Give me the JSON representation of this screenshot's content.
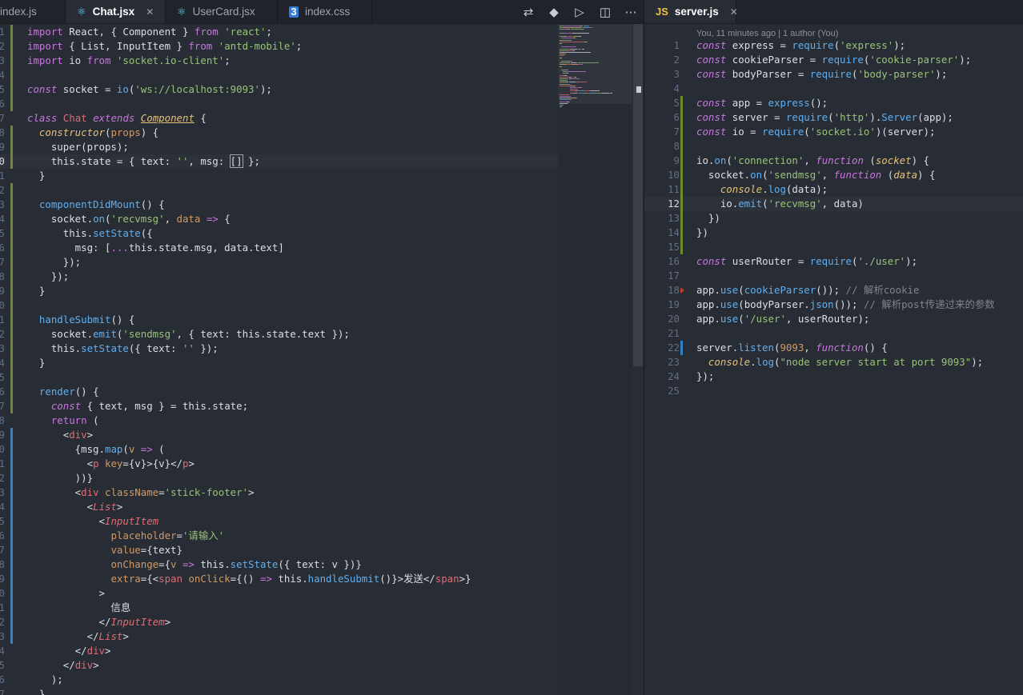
{
  "left_tabs": [
    {
      "label": "index.js",
      "icon": "none",
      "active": false
    },
    {
      "label": "Chat.jsx",
      "icon": "react-icon",
      "active": true
    },
    {
      "label": "UserCard.jsx",
      "icon": "react-icon",
      "active": false
    },
    {
      "label": "index.css",
      "icon": "css3-icon",
      "active": false
    }
  ],
  "right_tabs": [
    {
      "label": "server.js",
      "icon": "js-icon",
      "active": true
    }
  ],
  "toolbar_icons": [
    "compare-icon",
    "git-icon",
    "run-icon",
    "split-editor-icon",
    "more-icon"
  ],
  "server_codelens": "You, 11 minutes ago | 1 author (You)",
  "colors": {
    "keyword": "#c678dd",
    "string": "#98c379",
    "function": "#61afef",
    "tag": "#e06c75",
    "number": "#d19a66",
    "comment": "#7f848e"
  },
  "left_numbers": [
    "1",
    "2",
    "3",
    "4",
    "5",
    "6",
    "7",
    "8",
    "9",
    "0",
    "1",
    "2",
    "3",
    "4",
    "5",
    "6",
    "7",
    "8",
    "9",
    "0",
    "1",
    "2",
    "3",
    "4",
    "5",
    "6",
    "7",
    "8",
    "9",
    "0",
    "1",
    "2",
    "3",
    "4",
    "5",
    "6",
    "7",
    "8",
    "9",
    "0",
    "1",
    "2",
    "3",
    "4",
    "5",
    "6",
    "7"
  ],
  "left_current_line_index": 9,
  "left_code": [
    [
      [
        "k",
        "import"
      ],
      [
        "pl",
        " React, { Component } "
      ],
      [
        "k",
        "from"
      ],
      [
        "pl",
        " "
      ],
      [
        "s",
        "'react'"
      ],
      [
        "pl",
        ";"
      ]
    ],
    [
      [
        "k",
        "import"
      ],
      [
        "pl",
        " { List, InputItem } "
      ],
      [
        "k",
        "from"
      ],
      [
        "pl",
        " "
      ],
      [
        "s",
        "'antd-mobile'"
      ],
      [
        "pl",
        ";"
      ]
    ],
    [
      [
        "k",
        "import"
      ],
      [
        "pl",
        " io "
      ],
      [
        "k",
        "from"
      ],
      [
        "pl",
        " "
      ],
      [
        "s",
        "'socket.io-client'"
      ],
      [
        "pl",
        ";"
      ]
    ],
    [],
    [
      [
        "ki",
        "const"
      ],
      [
        "pl",
        " socket = "
      ],
      [
        "f",
        "io"
      ],
      [
        "pl",
        "("
      ],
      [
        "s",
        "'ws://localhost:9093'"
      ],
      [
        "pl",
        ");"
      ]
    ],
    [],
    [
      [
        "ki",
        "class"
      ],
      [
        "pl",
        " "
      ],
      [
        "t",
        "Chat"
      ],
      [
        "pl",
        " "
      ],
      [
        "ki",
        "extends"
      ],
      [
        "pl",
        " "
      ],
      [
        "pu",
        "Component"
      ],
      [
        "pl",
        " {"
      ]
    ],
    [
      [
        "pl",
        "  "
      ],
      [
        "p",
        "constructor"
      ],
      [
        "pl",
        "("
      ],
      [
        "a",
        "props"
      ],
      [
        "pl",
        ") {"
      ]
    ],
    [
      [
        "pl",
        "    super(props);"
      ]
    ],
    [
      [
        "pl",
        "    this.state = { text: "
      ],
      [
        "s",
        "''"
      ],
      [
        "pl",
        ", msg: "
      ],
      [
        "box",
        "[]"
      ],
      [
        "pl",
        " };"
      ]
    ],
    [
      [
        "pl",
        "  }"
      ]
    ],
    [],
    [
      [
        "pl",
        "  "
      ],
      [
        "f",
        "componentDidMount"
      ],
      [
        "pl",
        "() {"
      ]
    ],
    [
      [
        "pl",
        "    socket."
      ],
      [
        "f",
        "on"
      ],
      [
        "pl",
        "("
      ],
      [
        "s",
        "'recvmsg'"
      ],
      [
        "pl",
        ", "
      ],
      [
        "a",
        "data"
      ],
      [
        "pl",
        " "
      ],
      [
        "k",
        "=>"
      ],
      [
        "pl",
        " {"
      ]
    ],
    [
      [
        "pl",
        "      this."
      ],
      [
        "f",
        "setState"
      ],
      [
        "pl",
        "({"
      ]
    ],
    [
      [
        "pl",
        "        msg: ["
      ],
      [
        "k",
        "..."
      ],
      [
        "pl",
        "this.state.msg, data.text]"
      ]
    ],
    [
      [
        "pl",
        "      });"
      ]
    ],
    [
      [
        "pl",
        "    });"
      ]
    ],
    [
      [
        "pl",
        "  }"
      ]
    ],
    [],
    [
      [
        "pl",
        "  "
      ],
      [
        "f",
        "handleSubmit"
      ],
      [
        "pl",
        "() {"
      ]
    ],
    [
      [
        "pl",
        "    socket."
      ],
      [
        "f",
        "emit"
      ],
      [
        "pl",
        "("
      ],
      [
        "s",
        "'sendmsg'"
      ],
      [
        "pl",
        ", { text: this.state.text });"
      ]
    ],
    [
      [
        "pl",
        "    this."
      ],
      [
        "f",
        "setState"
      ],
      [
        "pl",
        "({ text: "
      ],
      [
        "s",
        "''"
      ],
      [
        "pl",
        " });"
      ]
    ],
    [
      [
        "pl",
        "  }"
      ]
    ],
    [],
    [
      [
        "pl",
        "  "
      ],
      [
        "f",
        "render"
      ],
      [
        "pl",
        "() {"
      ]
    ],
    [
      [
        "pl",
        "    "
      ],
      [
        "ki",
        "const"
      ],
      [
        "pl",
        " { text, msg } = this.state;"
      ]
    ],
    [
      [
        "pl",
        "    "
      ],
      [
        "k",
        "return"
      ],
      [
        "pl",
        " ("
      ]
    ],
    [
      [
        "pl",
        "      <"
      ],
      [
        "t",
        "div"
      ],
      [
        "pl",
        ">"
      ]
    ],
    [
      [
        "pl",
        "        {msg."
      ],
      [
        "f",
        "map"
      ],
      [
        "pl",
        "("
      ],
      [
        "a",
        "v"
      ],
      [
        "pl",
        " "
      ],
      [
        "k",
        "=>"
      ],
      [
        "pl",
        " ("
      ]
    ],
    [
      [
        "pl",
        "          <"
      ],
      [
        "t",
        "p"
      ],
      [
        "pl",
        " "
      ],
      [
        "a",
        "key"
      ],
      [
        "pl",
        "={v}>{v}</"
      ],
      [
        "t",
        "p"
      ],
      [
        "pl",
        ">"
      ]
    ],
    [
      [
        "pl",
        "        ))}"
      ]
    ],
    [
      [
        "pl",
        "        <"
      ],
      [
        "t",
        "div"
      ],
      [
        "pl",
        " "
      ],
      [
        "a",
        "className"
      ],
      [
        "pl",
        "="
      ],
      [
        "s",
        "'stick-footer'"
      ],
      [
        "pl",
        ">"
      ]
    ],
    [
      [
        "pl",
        "          <"
      ],
      [
        "ti",
        "List"
      ],
      [
        "pl",
        ">"
      ]
    ],
    [
      [
        "pl",
        "            <"
      ],
      [
        "ti",
        "InputItem"
      ]
    ],
    [
      [
        "pl",
        "              "
      ],
      [
        "a",
        "placeholder"
      ],
      [
        "pl",
        "="
      ],
      [
        "s",
        "'请输入'"
      ]
    ],
    [
      [
        "pl",
        "              "
      ],
      [
        "a",
        "value"
      ],
      [
        "pl",
        "={text}"
      ]
    ],
    [
      [
        "pl",
        "              "
      ],
      [
        "a",
        "onChange"
      ],
      [
        "pl",
        "={"
      ],
      [
        "a",
        "v"
      ],
      [
        "pl",
        " "
      ],
      [
        "k",
        "=>"
      ],
      [
        "pl",
        " this."
      ],
      [
        "f",
        "setState"
      ],
      [
        "pl",
        "({ text: v })}"
      ]
    ],
    [
      [
        "pl",
        "              "
      ],
      [
        "a",
        "extra"
      ],
      [
        "pl",
        "={<"
      ],
      [
        "t",
        "span"
      ],
      [
        "pl",
        " "
      ],
      [
        "a",
        "onClick"
      ],
      [
        "pl",
        "={() "
      ],
      [
        "k",
        "=>"
      ],
      [
        "pl",
        " this."
      ],
      [
        "f",
        "handleSubmit"
      ],
      [
        "pl",
        "()}>发送</"
      ],
      [
        "t",
        "span"
      ],
      [
        "pl",
        ">}"
      ]
    ],
    [
      [
        "pl",
        "            >"
      ]
    ],
    [
      [
        "pl",
        "              信息"
      ]
    ],
    [
      [
        "pl",
        "            </"
      ],
      [
        "ti",
        "InputItem"
      ],
      [
        "pl",
        ">"
      ]
    ],
    [
      [
        "pl",
        "          </"
      ],
      [
        "ti",
        "List"
      ],
      [
        "pl",
        ">"
      ]
    ],
    [
      [
        "pl",
        "        </"
      ],
      [
        "t",
        "div"
      ],
      [
        "pl",
        ">"
      ]
    ],
    [
      [
        "pl",
        "      </"
      ],
      [
        "t",
        "div"
      ],
      [
        "pl",
        ">"
      ]
    ],
    [
      [
        "pl",
        "    );"
      ]
    ],
    [
      [
        "pl",
        "  }"
      ]
    ]
  ],
  "right_numbers": [
    "1",
    "2",
    "3",
    "4",
    "5",
    "6",
    "7",
    "8",
    "9",
    "10",
    "11",
    "12",
    "13",
    "14",
    "15",
    "16",
    "17",
    "18",
    "19",
    "20",
    "21",
    "22",
    "23",
    "24",
    "25"
  ],
  "right_current_line_index": 11,
  "right_code": [
    [
      [
        "ki",
        "const"
      ],
      [
        "pl",
        " express = "
      ],
      [
        "f",
        "require"
      ],
      [
        "pl",
        "("
      ],
      [
        "s",
        "'express'"
      ],
      [
        "pl",
        ");"
      ]
    ],
    [
      [
        "ki",
        "const"
      ],
      [
        "pl",
        " cookieParser = "
      ],
      [
        "f",
        "require"
      ],
      [
        "pl",
        "("
      ],
      [
        "s",
        "'cookie-parser'"
      ],
      [
        "pl",
        ");"
      ]
    ],
    [
      [
        "ki",
        "const"
      ],
      [
        "pl",
        " bodyParser = "
      ],
      [
        "f",
        "require"
      ],
      [
        "pl",
        "("
      ],
      [
        "s",
        "'body-parser'"
      ],
      [
        "pl",
        ");"
      ]
    ],
    [],
    [
      [
        "ki",
        "const"
      ],
      [
        "pl",
        " app = "
      ],
      [
        "f",
        "express"
      ],
      [
        "pl",
        "();"
      ]
    ],
    [
      [
        "ki",
        "const"
      ],
      [
        "pl",
        " server = "
      ],
      [
        "f",
        "require"
      ],
      [
        "pl",
        "("
      ],
      [
        "s",
        "'http'"
      ],
      [
        "pl",
        ")."
      ],
      [
        "f",
        "Server"
      ],
      [
        "pl",
        "(app);"
      ]
    ],
    [
      [
        "ki",
        "const"
      ],
      [
        "pl",
        " io = "
      ],
      [
        "f",
        "require"
      ],
      [
        "pl",
        "("
      ],
      [
        "s",
        "'socket.io'"
      ],
      [
        "pl",
        ")(server);"
      ]
    ],
    [],
    [
      [
        "pl",
        "io."
      ],
      [
        "f",
        "on"
      ],
      [
        "pl",
        "("
      ],
      [
        "s",
        "'connection'"
      ],
      [
        "pl",
        ", "
      ],
      [
        "ki",
        "function"
      ],
      [
        "pl",
        " ("
      ],
      [
        "p",
        "socket"
      ],
      [
        "pl",
        ") {"
      ]
    ],
    [
      [
        "pl",
        "  socket."
      ],
      [
        "f",
        "on"
      ],
      [
        "pl",
        "("
      ],
      [
        "s",
        "'sendmsg'"
      ],
      [
        "pl",
        ", "
      ],
      [
        "ki",
        "function"
      ],
      [
        "pl",
        " ("
      ],
      [
        "p",
        "data"
      ],
      [
        "pl",
        ") {"
      ]
    ],
    [
      [
        "pl",
        "    "
      ],
      [
        "p",
        "console"
      ],
      [
        "pl",
        "."
      ],
      [
        "f",
        "log"
      ],
      [
        "pl",
        "(data);"
      ]
    ],
    [
      [
        "pl",
        "    io."
      ],
      [
        "f",
        "emit"
      ],
      [
        "pl",
        "("
      ],
      [
        "s",
        "'recvmsg'"
      ],
      [
        "pl",
        ", data)"
      ]
    ],
    [
      [
        "pl",
        "  })"
      ]
    ],
    [
      [
        "pl",
        "})"
      ]
    ],
    [],
    [
      [
        "ki",
        "const"
      ],
      [
        "pl",
        " userRouter = "
      ],
      [
        "f",
        "require"
      ],
      [
        "pl",
        "("
      ],
      [
        "s",
        "'./user'"
      ],
      [
        "pl",
        ");"
      ]
    ],
    [],
    [
      [
        "pl",
        "app."
      ],
      [
        "f",
        "use"
      ],
      [
        "pl",
        "("
      ],
      [
        "f",
        "cookieParser"
      ],
      [
        "pl",
        "()); "
      ],
      [
        "c",
        "// 解析cookie"
      ]
    ],
    [
      [
        "pl",
        "app."
      ],
      [
        "f",
        "use"
      ],
      [
        "pl",
        "(bodyParser."
      ],
      [
        "f",
        "json"
      ],
      [
        "pl",
        "()); "
      ],
      [
        "c",
        "// 解析post传递过来的参数"
      ]
    ],
    [
      [
        "pl",
        "app."
      ],
      [
        "f",
        "use"
      ],
      [
        "pl",
        "("
      ],
      [
        "s",
        "'/user'"
      ],
      [
        "pl",
        ", userRouter);"
      ]
    ],
    [],
    [
      [
        "pl",
        "server."
      ],
      [
        "f",
        "listen"
      ],
      [
        "pl",
        "("
      ],
      [
        "n",
        "9093"
      ],
      [
        "pl",
        ", "
      ],
      [
        "ki",
        "function"
      ],
      [
        "pl",
        "() {"
      ]
    ],
    [
      [
        "pl",
        "  "
      ],
      [
        "p",
        "console"
      ],
      [
        "pl",
        "."
      ],
      [
        "f",
        "log"
      ],
      [
        "pl",
        "("
      ],
      [
        "s",
        "\"node server start at port 9093\""
      ],
      [
        "pl",
        ");"
      ]
    ],
    [
      [
        "pl",
        "});"
      ]
    ],
    []
  ]
}
